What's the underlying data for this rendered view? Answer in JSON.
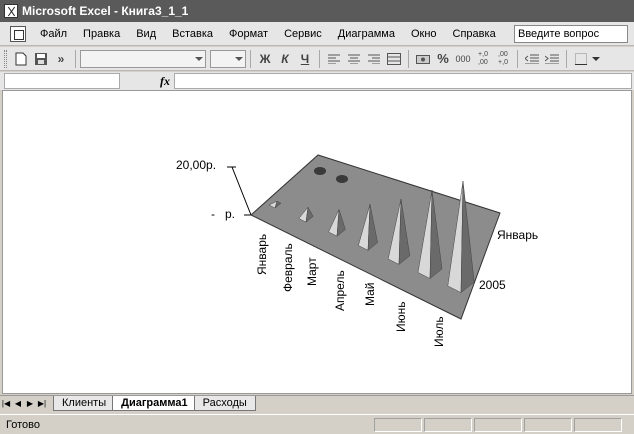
{
  "window": {
    "title": "Microsoft Excel - Книга3_1_1"
  },
  "menu": {
    "items": [
      "Файл",
      "Правка",
      "Вид",
      "Вставка",
      "Формат",
      "Сервис",
      "Диаграмма",
      "Окно",
      "Справка"
    ],
    "question_placeholder": "Введите вопрос"
  },
  "toolbar": {
    "bold_label": "Ж",
    "italic_label": "К",
    "underline_label": "Ч",
    "percent_label": "%",
    "thousands_label": "000",
    "more_label": "»",
    "increase_decimal_label": "+,0\n,00",
    "decrease_decimal_label": ",00\n+,0"
  },
  "formula_bar": {
    "fx_label": "fx",
    "name_box": "",
    "formula": ""
  },
  "chart_data": {
    "type": "3d-bar",
    "categories": [
      "Январь",
      "Февраль",
      "Март",
      "Апрель",
      "Май",
      "Июнь",
      "Июль"
    ],
    "series": [
      {
        "name": "2005",
        "values": [
          0.5,
          1.5,
          3,
          5.5,
          8,
          11,
          14
        ]
      }
    ],
    "depth_axis_labels": [
      "Январь",
      "2005"
    ],
    "y_tick_labels": [
      "20,00р.",
      "-   р."
    ],
    "ylim": [
      0,
      20
    ],
    "colors": {
      "floor": "#8c8c8c",
      "bar_light": "#d8d8d8",
      "bar_dark": "#6a6a6a"
    }
  },
  "sheets": {
    "tabs": [
      "Клиенты",
      "Диаграмма1",
      "Расходы"
    ],
    "active": "Диаграмма1"
  },
  "status": {
    "text": "Готово"
  }
}
